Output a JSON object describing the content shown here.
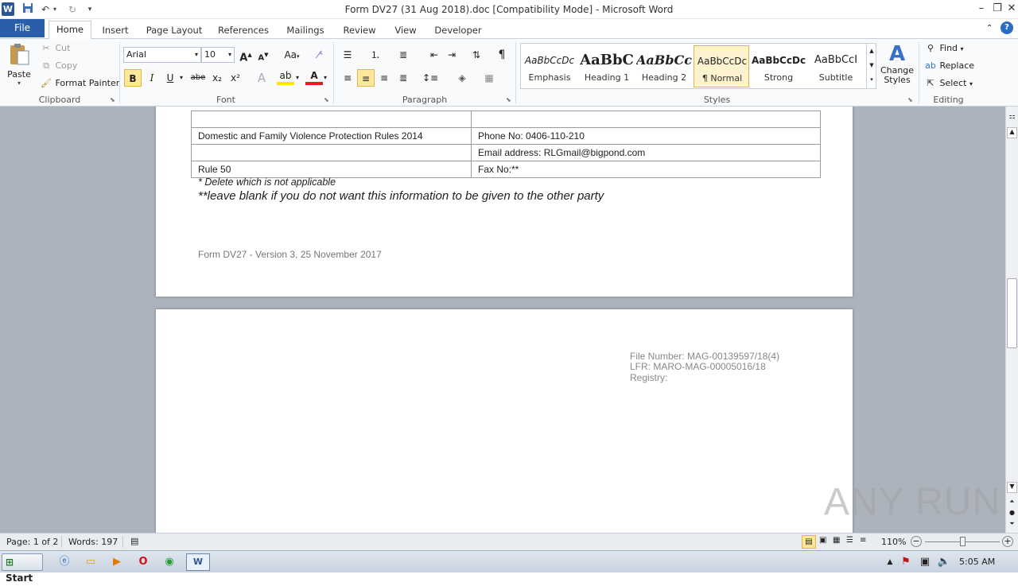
{
  "window": {
    "title": "Form DV27 (31 Aug 2018).doc [Compatibility Mode]  -  Microsoft Word",
    "app_icon": "W"
  },
  "tabs": [
    "File",
    "Home",
    "Insert",
    "Page Layout",
    "References",
    "Mailings",
    "Review",
    "View",
    "Developer"
  ],
  "clipboard": {
    "paste": "Paste",
    "cut": "Cut",
    "copy": "Copy",
    "format_painter": "Format Painter",
    "label": "Clipboard"
  },
  "font": {
    "name": "Arial",
    "size": "10",
    "label": "Font",
    "bold": "B",
    "italic": "I",
    "underline": "U",
    "strike": "abe",
    "sub": "x₂",
    "sup": "x²",
    "grow": "A",
    "shrink": "A",
    "case": "Aa"
  },
  "paragraph": {
    "label": "Paragraph",
    "pilcrow": "¶"
  },
  "styles": {
    "label": "Styles",
    "items": [
      {
        "sample": "AaBbCcDc",
        "name": "Emphasis"
      },
      {
        "sample": "AaBbC",
        "name": "Heading 1"
      },
      {
        "sample": "AaBbCc",
        "name": "Heading 2"
      },
      {
        "sample": "AaBbCcDc",
        "name": "¶ Normal"
      },
      {
        "sample": "AaBbCcDc",
        "name": "Strong"
      },
      {
        "sample": "AaBbCcI",
        "name": "Subtitle"
      }
    ],
    "change_styles": "Change Styles"
  },
  "editing": {
    "label": "Editing",
    "find": "Find",
    "replace": "Replace",
    "select": "Select"
  },
  "doc": {
    "table_rows": [
      {
        "left": "Domestic and Family Violence Protection Rules 2014",
        "right": "Phone No: 0406-110-210"
      },
      {
        "left": "",
        "right": "Email address:  RLGmail@bigpond.com"
      },
      {
        "left": "Rule 50",
        "right": "Fax No:**"
      }
    ],
    "note1": "* Delete which is not applicable",
    "note2": "**leave blank if you do not want  this information to be given to the other party",
    "footer": "Form DV27 - Version 3, 25 November 2017",
    "file_number": "File Number: MAG-00139597/18(4)",
    "lfr": "LFR: MARO-MAG-00005016/18",
    "registry": "Registry:"
  },
  "status": {
    "page": "Page: 1 of 2",
    "words": "Words: 197",
    "zoom": "110%"
  },
  "taskbar": {
    "start": "Start",
    "time": "5:05 AM"
  },
  "watermark": "ANY RUN"
}
